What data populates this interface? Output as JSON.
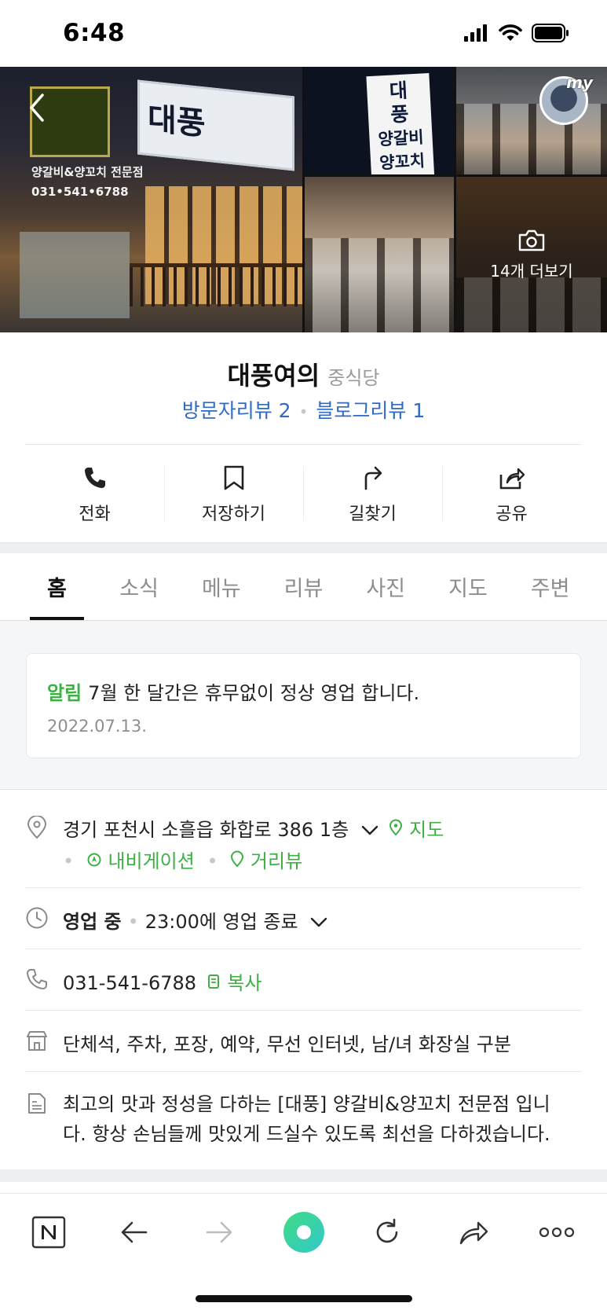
{
  "status_bar": {
    "time": "6:48"
  },
  "gallery": {
    "main_sign_text": "대풍",
    "main_side_text": [
      "양갈비&양꼬치 전문점",
      "031•541•6788"
    ],
    "banner_text": [
      "대",
      "풍",
      "양갈비",
      "양꼬치"
    ],
    "more_label": "14개 더보기",
    "my_badge": "my"
  },
  "place": {
    "name": "대풍여의",
    "category": "중식당",
    "visitor_reviews": "방문자리뷰 2",
    "blog_reviews": "블로그리뷰 1"
  },
  "actions": [
    {
      "label": "전화",
      "icon": "phone-icon"
    },
    {
      "label": "저장하기",
      "icon": "bookmark-icon"
    },
    {
      "label": "길찾기",
      "icon": "directions-icon"
    },
    {
      "label": "공유",
      "icon": "share-icon"
    }
  ],
  "tabs": [
    {
      "label": "홈",
      "active": true
    },
    {
      "label": "소식"
    },
    {
      "label": "메뉴"
    },
    {
      "label": "리뷰"
    },
    {
      "label": "사진"
    },
    {
      "label": "지도"
    },
    {
      "label": "주변"
    }
  ],
  "notice": {
    "tag": "알림",
    "text": "7월 한 달간은 휴무없이 정상 영업 합니다.",
    "date": "2022.07.13."
  },
  "info": {
    "address": "경기 포천시 소흘읍 화합로 386 1층",
    "map_link": "지도",
    "navigation_link": "내비게이션",
    "street_view_link": "거리뷰",
    "hours_status": "영업 중",
    "hours_detail": "23:00에 영업 종료",
    "phone": "031-541-6788",
    "copy_label": "복사",
    "facilities": "단체석, 주차, 포장, 예약, 무선 인터넷, 남/녀 화장실 구분",
    "description_line1": "최고의 맛과 정성을 다하는 [대풍] 양갈비&양꼬치 전문점 입니",
    "description_line2": "다. 항상 손님들께 맛있게 드실수 있도록 최선을 다하겠습니다."
  },
  "colors": {
    "accent_green": "#3cb043",
    "link_blue": "#2f6ac7"
  }
}
